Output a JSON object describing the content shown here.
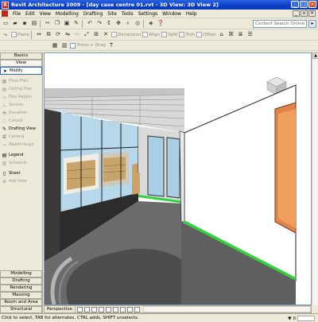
{
  "window": {
    "title": "Revit Architecture 2009 - [day case centre 01.rvt - 3D View: 3D View 2]",
    "app_icon_letter": "R"
  },
  "menu": {
    "items": [
      "File",
      "Edit",
      "View",
      "Modelling",
      "Drafting",
      "Site",
      "Tools",
      "Settings",
      "Window",
      "Help"
    ]
  },
  "toolbar3": {
    "plane": "Plane",
    "dimension": "Dimension",
    "align": "Align",
    "split": "Split",
    "trim": "Trim",
    "offset": "Offset",
    "move": "Move",
    "press_drag": "Press + Drag"
  },
  "search": {
    "placeholder": "Content Search Online"
  },
  "sidebar": {
    "top_tabs": [
      "Basics",
      "View"
    ],
    "modify": "Modify",
    "items": [
      {
        "label": "Floor Plan",
        "icon": "floor-plan-icon"
      },
      {
        "label": "Ceiling Plan",
        "icon": "ceiling-plan-icon"
      },
      {
        "label": "Plan Region",
        "icon": "plan-region-icon"
      },
      {
        "label": "Section",
        "icon": "section-icon"
      },
      {
        "label": "Elevation",
        "icon": "elevation-icon"
      },
      {
        "label": "Callout",
        "icon": "callout-icon"
      }
    ],
    "drafting_view": "Drafting View",
    "items2": [
      {
        "label": "Camera",
        "icon": "camera-icon"
      },
      {
        "label": "Walkthrough",
        "icon": "walkthrough-icon"
      }
    ],
    "legend": "Legend",
    "schedule": "Schedule",
    "sheet": "Sheet",
    "add_view": "Add View",
    "bottom_tabs": [
      "Modelling",
      "Drafting",
      "Rendering",
      "Massing",
      "Room and Area",
      "Structural"
    ]
  },
  "view": {
    "label": "Perspective"
  },
  "status": {
    "text": "Click to select, TAB for alternates, CTRL adds, SHIFT unselects.",
    "filter_count": "0"
  },
  "colors": {
    "title_blue": "#0a3fc8",
    "green_strip": "#2ed43a",
    "door_orange": "#e2844a"
  }
}
